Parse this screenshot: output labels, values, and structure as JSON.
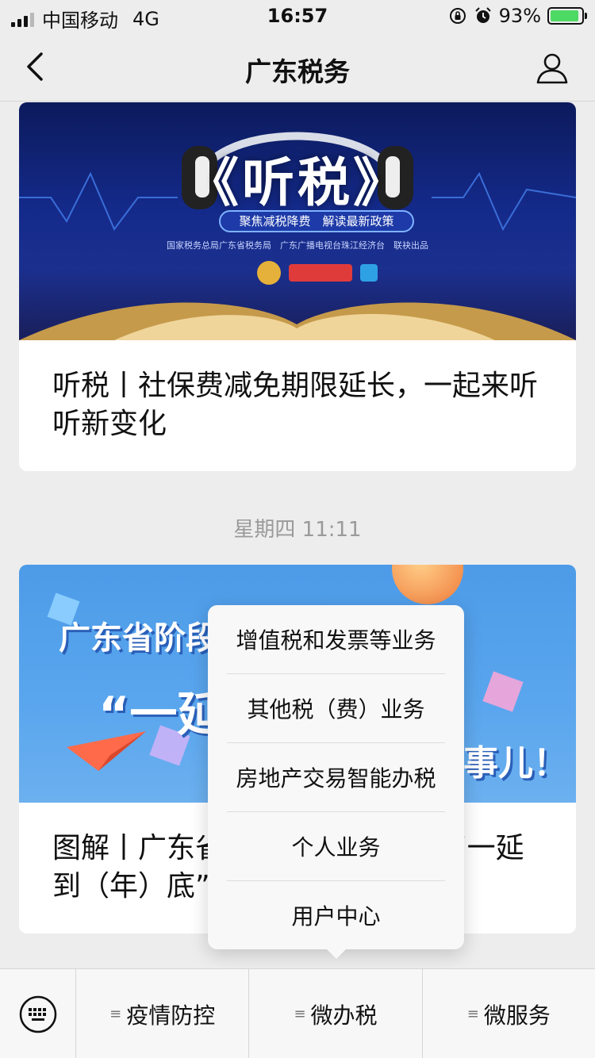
{
  "status_bar": {
    "carrier": "中国移动",
    "network": "4G",
    "time": "16:57",
    "battery_percent": "93%",
    "battery_level": 0.93,
    "icons": [
      "signal-icon",
      "rotation-lock-icon",
      "alarm-icon",
      "battery-charging-icon"
    ]
  },
  "navbar": {
    "title": "广东税务",
    "back_icon": "chevron-left-icon",
    "profile_icon": "user-icon"
  },
  "messages": [
    {
      "title": "听税丨社保费减免期限延长，一起来听听新变化",
      "banner": {
        "headline": "《听税》",
        "pill": "聚焦减税降费　解读最新政策",
        "subline": "国家税务总局广东省税务局　广东广播电视台珠江经济台　联袂出品",
        "logos": [
          "tax-emblem-logo",
          "radio-station-logo",
          "channel-logo"
        ]
      }
    },
    {
      "timestamp": "星期四 11:11",
      "title": "图解丨广东省阶段性减免社保费“一延到（年）底”",
      "banner": {
        "headline": "广东省阶段性减免社保费",
        "quote": "“一延",
        "right": "事儿！"
      }
    }
  ],
  "popup_menu": {
    "items": [
      "增值税和发票等业务",
      "其他税（费）业务",
      "房地产交易智能办税",
      "个人业务",
      "用户中心"
    ]
  },
  "bottom_menu": {
    "keyboard_icon": "keyboard-icon",
    "items": [
      "疫情防控",
      "微办税",
      "微服务"
    ],
    "item_icon": "menu-lines-icon"
  }
}
